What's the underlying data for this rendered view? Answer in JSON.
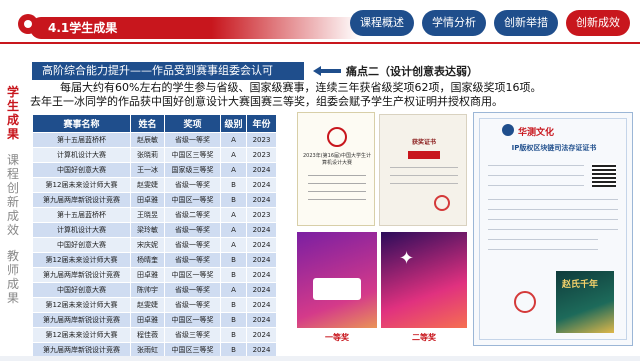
{
  "header": {
    "title": "4.1学生成果",
    "tabs": [
      {
        "label": "课程概述",
        "active": false
      },
      {
        "label": "学情分析",
        "active": false
      },
      {
        "label": "创新举措",
        "active": false
      },
      {
        "label": "创新成效",
        "active": true
      }
    ]
  },
  "side_nav": {
    "items": [
      {
        "label": "学生成果",
        "active": true
      },
      {
        "label": "课程创新成效",
        "active": false
      },
      {
        "label": "教师成果",
        "active": false
      }
    ]
  },
  "banner": {
    "text": "高阶综合能力提升——作品受到赛事组委会认可",
    "pain_point": "痛点二（设计创意表达弱）"
  },
  "summary": {
    "line1": "每届大约有60%左右的学生参与省级、国家级赛事，连续三年获省级奖项62项，国家级奖项16项。",
    "line2": "去年王一冰同学的作品获中国好创意设计大赛国赛三等奖，组委会赋予学生产权证明并授权商用。"
  },
  "table": {
    "headers": [
      "赛事名称",
      "姓名",
      "奖项",
      "级别",
      "年份"
    ],
    "rows": [
      [
        "第十五届蓝桥杯",
        "赵辰敏",
        "省级一等奖",
        "A",
        "2023"
      ],
      [
        "计算机设计大赛",
        "张晓莉",
        "中国区三等奖",
        "A",
        "2023"
      ],
      [
        "中国好创意大赛",
        "王一冰",
        "国家级三等奖",
        "A",
        "2024"
      ],
      [
        "第12届未来设计师大赛",
        "赵雯婕",
        "省级一等奖",
        "B",
        "2024"
      ],
      [
        "第九届两岸新锐设计竞赛",
        "田卓雅",
        "中国区一等奖",
        "B",
        "2024"
      ],
      [
        "第十五届蓝桥杯",
        "王晓昱",
        "省级二等奖",
        "A",
        "2023"
      ],
      [
        "计算机设计大赛",
        "梁玲敏",
        "省级一等奖",
        "A",
        "2024"
      ],
      [
        "中国好创意大赛",
        "宋庆妮",
        "省级一等奖",
        "A",
        "2024"
      ],
      [
        "第12届未来设计师大赛",
        "杨晴奎",
        "省级一等奖",
        "B",
        "2024"
      ],
      [
        "第九届两岸新锐设计竞赛",
        "田卓雅",
        "中国区一等奖",
        "B",
        "2024"
      ],
      [
        "中国好创意大赛",
        "陈帅宇",
        "省级一等奖",
        "A",
        "2024"
      ],
      [
        "第12届未来设计师大赛",
        "赵雯婕",
        "省级一等奖",
        "B",
        "2024"
      ],
      [
        "第九届两岸新锐设计竞赛",
        "田卓雅",
        "中国区一等奖",
        "B",
        "2024"
      ],
      [
        "第12届未来设计师大赛",
        "程佳薇",
        "省级三等奖",
        "B",
        "2024"
      ],
      [
        "第九届两岸新锐设计竞赛",
        "张雨虹",
        "中国区三等奖",
        "B",
        "2024"
      ]
    ]
  },
  "certificates": {
    "cert1_text": "2023年(第16届)中国大学生计算机设计大赛",
    "cert2_heading": "获奖证书",
    "poster1_caption": "一等奖",
    "poster2_caption": "二等奖",
    "blockchain_logo": "华测文化",
    "blockchain_title": "IP版权区块链司法存证证书",
    "blockchain_image_text": "赵氏千年"
  },
  "colors": {
    "brand_red": "#c8161d",
    "brand_blue": "#1f4e8c",
    "row_dark": "#cfdcf1",
    "row_light": "#e7eef8"
  }
}
